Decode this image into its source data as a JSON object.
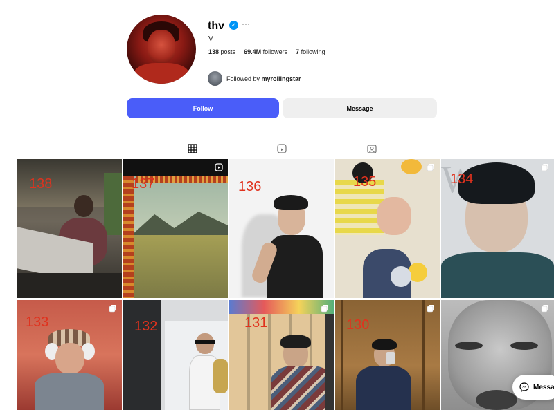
{
  "profile": {
    "username": "thv",
    "verified_icon": "verified-badge-icon",
    "more_icon": "···",
    "full_name": "V",
    "stats": [
      {
        "value": "138",
        "label": "posts"
      },
      {
        "value": "69.4M",
        "label": "followers"
      },
      {
        "value": "7",
        "label": "following"
      }
    ],
    "followed_by_prefix": "Followed by",
    "followed_by_user": "myrollingstar"
  },
  "actions": {
    "follow_label": "Follow",
    "message_label": "Message"
  },
  "tabs": [
    {
      "name": "posts",
      "icon": "grid-icon",
      "active": true
    },
    {
      "name": "reels",
      "icon": "reels-icon",
      "active": false
    },
    {
      "name": "tagged",
      "icon": "tagged-icon",
      "active": false
    }
  ],
  "posts": [
    {
      "label": "138",
      "corner_icon": ""
    },
    {
      "label": "137",
      "corner_icon": "reels-icon"
    },
    {
      "label": "136",
      "corner_icon": ""
    },
    {
      "label": "135",
      "corner_icon": "carousel-icon"
    },
    {
      "label": "134",
      "corner_icon": "carousel-icon"
    },
    {
      "label": "133",
      "corner_icon": "carousel-icon"
    },
    {
      "label": "132",
      "corner_icon": ""
    },
    {
      "label": "131",
      "corner_icon": "carousel-icon"
    },
    {
      "label": "130",
      "corner_icon": "carousel-icon"
    },
    {
      "label": "",
      "corner_icon": "carousel-icon"
    }
  ],
  "messages_pill": {
    "label": "Messa",
    "icon": "messenger-icon"
  },
  "colors": {
    "follow": "#4a5df9",
    "message": "#efefef",
    "annotation": "#e0321e",
    "verified": "#0095f6"
  }
}
